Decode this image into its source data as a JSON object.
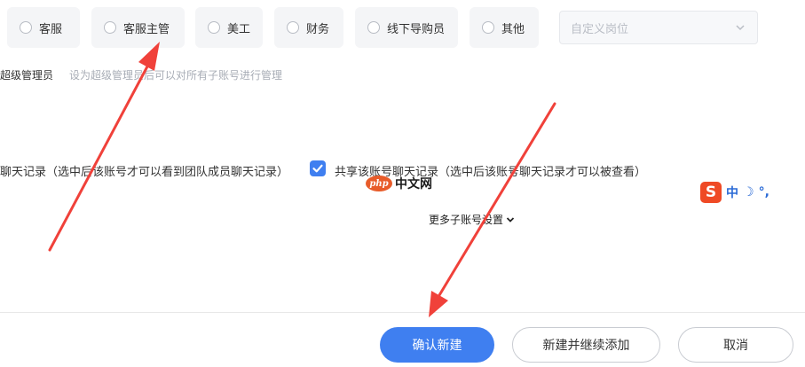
{
  "roles": [
    {
      "label": "客服"
    },
    {
      "label": "客服主管"
    },
    {
      "label": "美工"
    },
    {
      "label": "财务"
    },
    {
      "label": "线下导购员"
    },
    {
      "label": "其他"
    }
  ],
  "custom_role": {
    "placeholder": "自定义岗位"
  },
  "super_admin": {
    "label": "超级管理员",
    "hint": "设为超级管理员后可以对所有子账号进行管理"
  },
  "chat_records": {
    "view_team_label": "聊天记录（选中后该账号才可以看到团队成员聊天记录）",
    "share_label": "共享该账号聊天记录（选中后该账号聊天记录才可以被查看）",
    "share_checked": true
  },
  "more_settings": {
    "label": "更多子账号设置"
  },
  "actions": {
    "confirm": "确认新建",
    "create_continue": "新建并继续添加",
    "cancel": "取消"
  },
  "watermark": {
    "logo": "php",
    "text": "中文网"
  },
  "ime_toolbar": {
    "logo": "S",
    "lang": "中",
    "moon": "☽",
    "punct": "°,"
  },
  "colors": {
    "primary": "#3f7ff0",
    "arrow": "#f0413a"
  }
}
